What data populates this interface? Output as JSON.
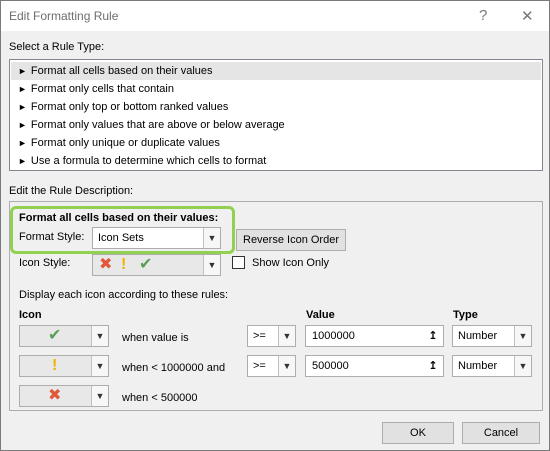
{
  "window": {
    "title": "Edit Formatting Rule",
    "help": "?",
    "close": "✕"
  },
  "rule_type": {
    "label": "Select a Rule Type:",
    "items": [
      "Format all cells based on their values",
      "Format only cells that contain",
      "Format only top or bottom ranked values",
      "Format only values that are above or below average",
      "Format only unique or duplicate values",
      "Use a formula to determine which cells to format"
    ],
    "selected_index": 0
  },
  "description": {
    "label": "Edit the Rule Description:",
    "heading": "Format all cells based on their values:",
    "format_style_label": "Format Style:",
    "format_style_value": "Icon Sets",
    "reverse_button": "Reverse Icon Order",
    "icon_style_label": "Icon Style:",
    "show_icon_only_label": "Show Icon Only",
    "show_icon_only_checked": false,
    "display_rules_label": "Display each icon according to these rules:",
    "col_icon": "Icon",
    "col_value": "Value",
    "col_type": "Type",
    "rows": [
      {
        "icon": "check-icon",
        "text": "when value is",
        "operator": ">=",
        "value": "1000000",
        "type": "Number"
      },
      {
        "icon": "exclamation-icon",
        "text": "when < 1000000 and",
        "operator": ">=",
        "value": "500000",
        "type": "Number"
      },
      {
        "icon": "cross-icon",
        "text": "when < 500000"
      }
    ]
  },
  "buttons": {
    "ok": "OK",
    "cancel": "Cancel"
  },
  "colors": {
    "highlight": "#92d050",
    "check": "#5a9e5a",
    "exclamation": "#f0b400",
    "cross": "#e05a3a"
  }
}
